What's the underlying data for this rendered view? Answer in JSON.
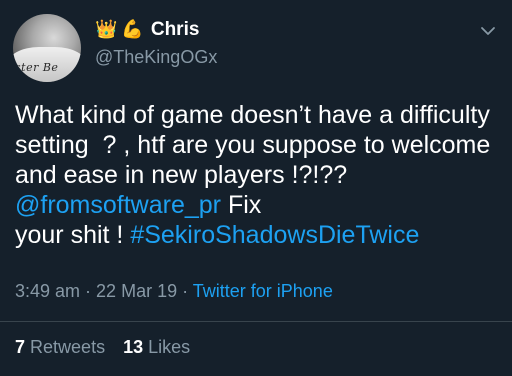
{
  "tweet": {
    "author": {
      "emoji_crown": "👑",
      "emoji_muscle": "💪",
      "display_name": "Chris",
      "handle": "@TheKingOGx",
      "avatar_shirt_text": "ster Be"
    },
    "text_lines": [
      {
        "text": "What kind of game doesn’t have "
      },
      {
        "text": "a difficulty setting  ? , htf are you "
      },
      {
        "text": "suppose to welcome and ease in new "
      },
      {
        "text": "players !?!?? "
      },
      {
        "mention": "@fromsoftware_pr"
      },
      {
        "text": " Fix\nyour shit ! "
      },
      {
        "hashtag": "#SekiroShadowsDieTwice"
      }
    ],
    "time": "3:49 am",
    "date": "22 Mar 19",
    "separator": " · ",
    "source": "Twitter for iPhone",
    "retweets_count": "7",
    "retweets_label": "Retweets",
    "likes_count": "13",
    "likes_label": "Likes"
  },
  "colors": {
    "background": "#15202b",
    "text": "#ffffff",
    "secondary": "#8899a6",
    "link": "#1da1f2",
    "divider": "#38444d"
  },
  "icons": {
    "caret": "chevron-down-icon"
  }
}
